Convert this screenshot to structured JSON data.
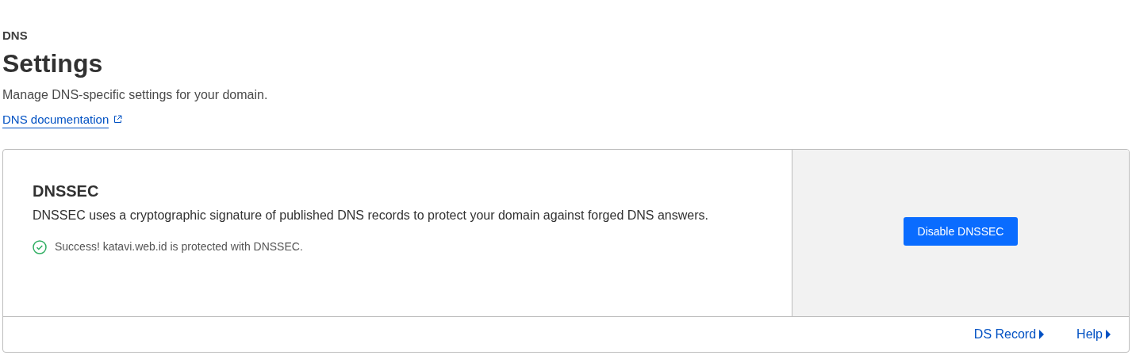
{
  "breadcrumb": "DNS",
  "title": "Settings",
  "description": "Manage DNS-specific settings for your domain.",
  "doc_link": {
    "label": "DNS documentation"
  },
  "card": {
    "title": "DNSSEC",
    "description": "DNSSEC uses a cryptographic signature of published DNS records to protect your domain against forged DNS answers.",
    "status": {
      "kind": "success",
      "text": "Success! katavi.web.id is protected with DNSSEC."
    },
    "action_button": "Disable DNSSEC",
    "footer_links": [
      {
        "label": "DS Record"
      },
      {
        "label": "Help"
      }
    ]
  }
}
